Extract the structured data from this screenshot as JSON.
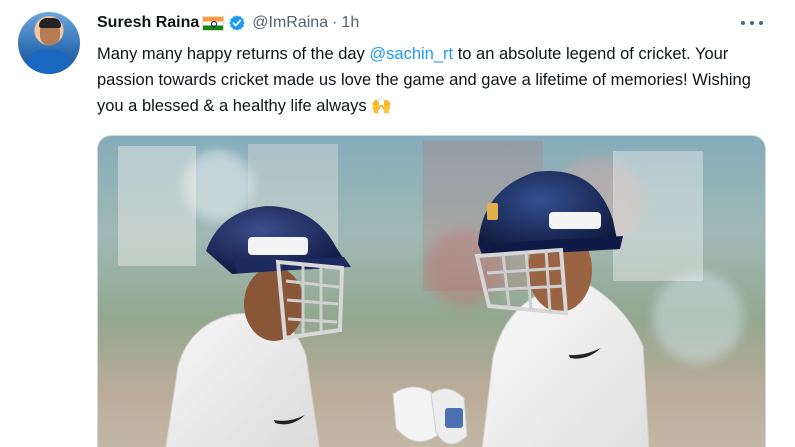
{
  "tweet": {
    "display_name": "Suresh Raina",
    "handle": "@ImRaina",
    "dot": "·",
    "time": "1h",
    "text_before": "Many many happy returns of the day ",
    "mention": "@sachin_rt",
    "text_after": " to an absolute legend of cricket. Your passion towards cricket made us love the game and gave a lifetime of memories! Wishing you a blessed & a healthy life always ",
    "emoji": "🙌"
  },
  "colors": {
    "link": "#1d9bf0",
    "verified": "#1d9bf0",
    "text": "#0f1419",
    "muted": "#536471"
  },
  "icons": {
    "flag": "india-flag-icon",
    "verified": "verified-badge-icon",
    "more": "more-options-icon"
  }
}
